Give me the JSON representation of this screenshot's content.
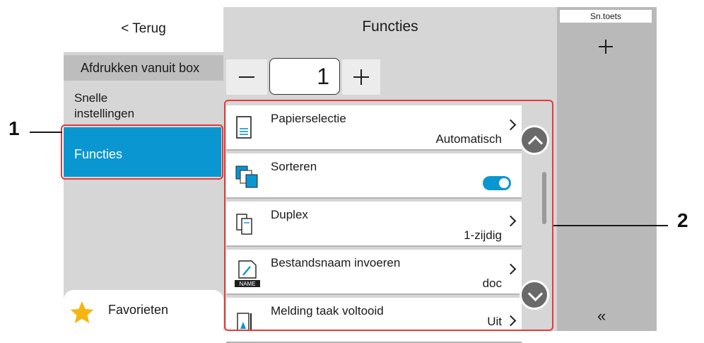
{
  "sidebar": {
    "back_label": "< Terug",
    "header": "Afdrukken vanuit box",
    "quick_settings": "Snelle\ninstellingen",
    "functions": "Functies",
    "favorites": "Favorieten"
  },
  "main": {
    "title": "Functies",
    "copies": "1",
    "items": [
      {
        "label": "Papierselectie",
        "value": "Automatisch",
        "icon": "paper-tray-icon"
      },
      {
        "label": "Sorteren",
        "value": "",
        "icon": "collate-icon",
        "toggle_on": true
      },
      {
        "label": "Duplex",
        "value": "1-zijdig",
        "icon": "duplex-icon"
      },
      {
        "label": "Bestandsnaam invoeren",
        "value": "doc",
        "icon": "filename-icon",
        "icon_text": "NAME"
      },
      {
        "label": "Melding taak voltooid",
        "value": "Uit",
        "icon": "job-finish-notice-icon"
      }
    ]
  },
  "right_panel": {
    "shortcut_tab": "Sn.toets",
    "add_icon": "plus-icon",
    "collapse_label": "«"
  },
  "callouts": {
    "one": "1",
    "two": "2"
  },
  "colors": {
    "accent": "#0a96d1",
    "highlight": "#e23b3b"
  }
}
